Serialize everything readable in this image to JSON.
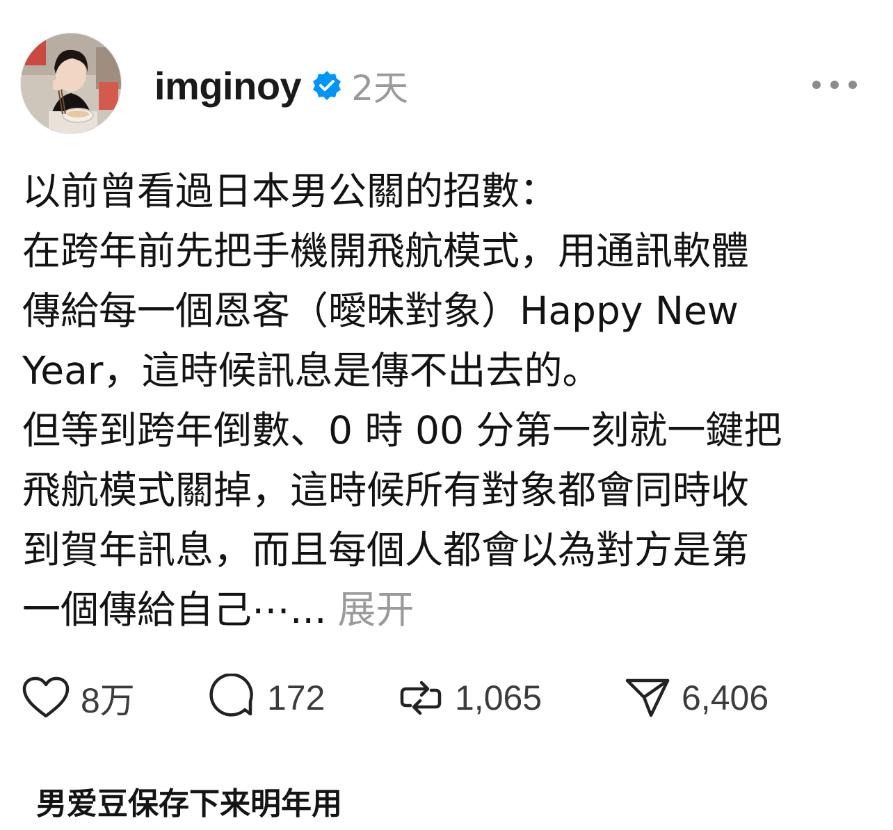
{
  "post": {
    "username": "imginoy",
    "timestamp": "2天",
    "avatar": "avatar-photo",
    "verified_icon": "verified-badge-icon",
    "more_icon": "more-options-icon",
    "body_lines": [
      "以前曾看過日本男公關的招數：",
      "在跨年前先把手機開飛航模式，用通訊軟體",
      "傳給每一個恩客（曖昧對象）Happy New",
      "Year，這時候訊息是傳不出去的。",
      "但等到跨年倒數、0 時 00 分第一刻就一鍵把",
      "飛航模式關掉，這時候所有對象都會同時收",
      "到賀年訊息，而且每個人都會以為對方是第",
      "一個傳給自己⋯..."
    ],
    "expand_label": "展开",
    "actions": {
      "like_count": "8万",
      "comment_count": "172",
      "repost_count": "1,065",
      "share_count": "6,406"
    }
  },
  "caption": "男爱豆保存下来明年用",
  "colors": {
    "verified_blue": "#0095f6",
    "muted_gray": "#9a9a9a",
    "text_dark": "#131313"
  }
}
